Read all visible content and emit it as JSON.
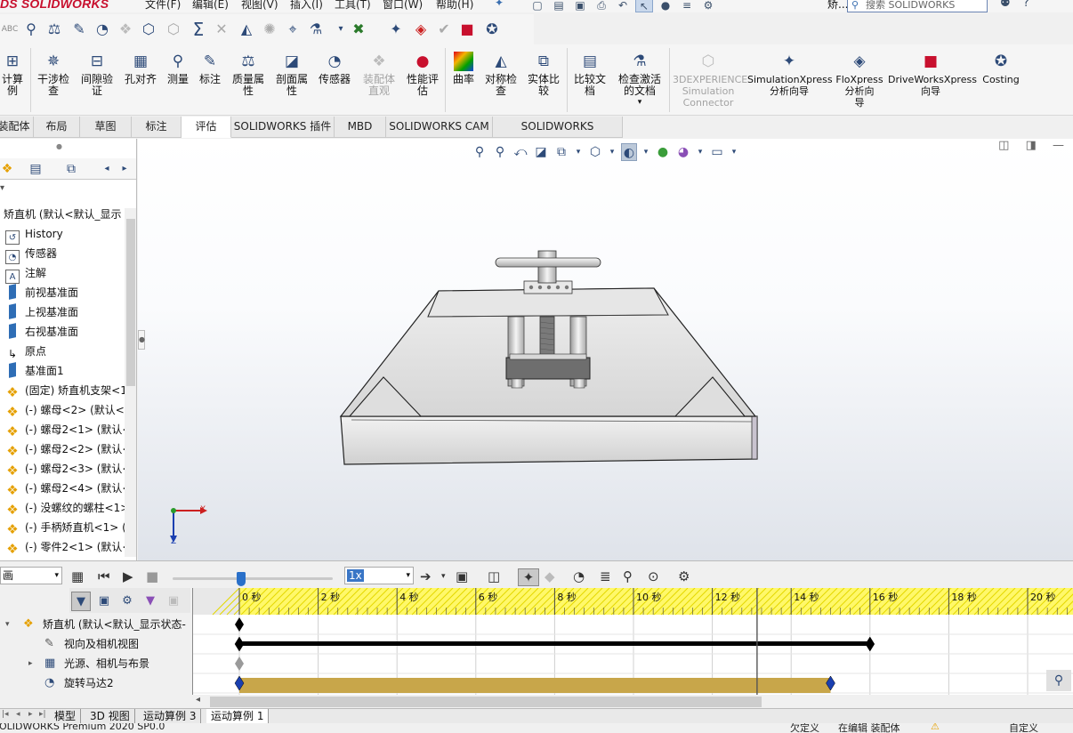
{
  "app": {
    "brand_ds": "DS",
    "brand_name": "SOLIDWORKS",
    "menu": [
      "文件(F)",
      "编辑(E)",
      "视图(V)",
      "插入(I)",
      "工具(T)",
      "窗口(W)",
      "帮助(H)"
    ],
    "search_placeholder": "搜索 SOLIDWORKS",
    "right_status": "矫..."
  },
  "ribbon": {
    "items": [
      {
        "label": "计算\n例",
        "icon": "calculator-icon"
      },
      {
        "label": "干涉检\n查",
        "icon": "interference-check-icon"
      },
      {
        "label": "间隙验\n证",
        "icon": "clearance-verification-icon"
      },
      {
        "label": "孔对齐",
        "icon": "hole-alignment-icon"
      },
      {
        "label": "测量",
        "icon": "measure-icon"
      },
      {
        "label": "标注",
        "icon": "annotation-icon"
      },
      {
        "label": "质量属\n性",
        "icon": "mass-properties-icon"
      },
      {
        "label": "剖面属\n性",
        "icon": "section-properties-icon"
      },
      {
        "label": "传感器",
        "icon": "sensor-icon"
      },
      {
        "label": "装配体\n直观",
        "icon": "assembly-visualization-icon",
        "disabled": true
      },
      {
        "label": "性能评\n估",
        "icon": "performance-evaluation-icon"
      },
      {
        "label": "曲率",
        "icon": "curvature-icon"
      },
      {
        "label": "对称检\n查",
        "icon": "symmetry-check-icon"
      },
      {
        "label": "实体比\n较",
        "icon": "body-compare-icon"
      },
      {
        "label": "比较文\n档",
        "icon": "compare-documents-icon"
      },
      {
        "label": "检查激活\n的文档",
        "icon": "check-active-document-icon"
      },
      {
        "label": "3DEXPERIENCE\nSimulation\nConnector",
        "icon": "3dexperience-icon",
        "disabled": true
      },
      {
        "label": "SimulationXpress\n分析向导",
        "icon": "simulationxpress-icon"
      },
      {
        "label": "FloXpress\n分析向\n导",
        "icon": "floxpress-icon"
      },
      {
        "label": "DriveWorksXpress\n向导",
        "icon": "driveworksxpress-icon"
      },
      {
        "label": "Costing",
        "icon": "costing-icon"
      }
    ]
  },
  "tabs": [
    "装配体",
    "布局",
    "草图",
    "标注",
    "评估",
    "SOLIDWORKS 插件",
    "MBD",
    "SOLIDWORKS CAM",
    "SOLIDWORKS Inspection"
  ],
  "active_tab": "评估",
  "feature_tree": {
    "root": "矫直机 (默认<默认_显示",
    "items": [
      {
        "label": "History",
        "icon": "history-icon"
      },
      {
        "label": "传感器",
        "icon": "sensor-icon"
      },
      {
        "label": "注解",
        "icon": "annotation-icon"
      },
      {
        "label": "前视基准面",
        "icon": "plane-icon"
      },
      {
        "label": "上视基准面",
        "icon": "plane-icon"
      },
      {
        "label": "右视基准面",
        "icon": "plane-icon"
      },
      {
        "label": "原点",
        "icon": "origin-icon"
      },
      {
        "label": "基准面1",
        "icon": "plane-icon"
      },
      {
        "label": "(固定) 矫直机支架<1",
        "icon": "part-icon"
      },
      {
        "label": "(-) 螺母<2> (默认<",
        "icon": "part-icon"
      },
      {
        "label": "(-) 螺母2<1> (默认<",
        "icon": "part-icon"
      },
      {
        "label": "(-) 螺母2<2> (默认<",
        "icon": "part-icon"
      },
      {
        "label": "(-) 螺母2<3> (默认<",
        "icon": "part-icon"
      },
      {
        "label": "(-) 螺母2<4> (默认<",
        "icon": "part-icon"
      },
      {
        "label": "(-) 没螺纹的螺柱<1>",
        "icon": "part-icon"
      },
      {
        "label": "(-) 手柄矫直机<1> (",
        "icon": "part-icon"
      },
      {
        "label": "(-) 零件2<1> (默认<",
        "icon": "part-icon"
      }
    ]
  },
  "viewport": {
    "axis_x": "X",
    "axis_z": "Z"
  },
  "motion": {
    "study_type": "画",
    "speed": "1x",
    "time_unit": "秒",
    "ticks": [
      0,
      2,
      4,
      6,
      8,
      10,
      12,
      14,
      16,
      18,
      20
    ],
    "current_time": 13,
    "slider_fraction": 0.43,
    "tree": [
      {
        "label": "矫直机 (默认<默认_显示状态-",
        "icon": "assembly-icon",
        "expand": "▾",
        "indent": 0
      },
      {
        "label": "视向及相机视图",
        "icon": "camera-view-icon",
        "indent": 1
      },
      {
        "label": "光源、相机与布景",
        "icon": "lights-cameras-icon",
        "expand": "▸",
        "indent": 1
      },
      {
        "label": "旋转马达2",
        "icon": "rotary-motor-icon",
        "indent": 1
      }
    ],
    "tracks": [
      {
        "row": 0,
        "type": "key",
        "start": 0
      },
      {
        "row": 1,
        "type": "bar",
        "start": 0,
        "end": 16,
        "color": "#000000"
      },
      {
        "row": 2,
        "type": "key-gray",
        "start": 0
      },
      {
        "row": 3,
        "type": "bar",
        "start": 0,
        "end": 15,
        "color": "#c8a64a"
      }
    ]
  },
  "bottom_tabs": [
    "模型",
    "3D 视图",
    "运动算例 3",
    "运动算例 1"
  ],
  "active_bottom_tab": "运动算例 1",
  "status": {
    "left": "SOLIDWORKS Premium 2020 SP0.0",
    "center": "欠定义",
    "edit": "在编辑 装配体",
    "custom": "自定义"
  },
  "colors": {
    "accent": "#2a70c9",
    "brand": "#c8102e",
    "timeline_ruler": "#fff86a"
  }
}
